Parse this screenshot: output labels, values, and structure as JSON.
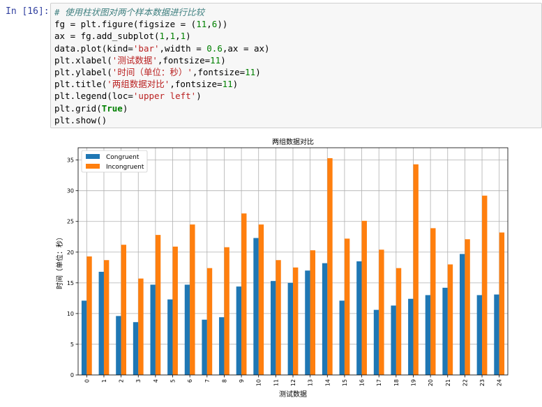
{
  "cell": {
    "prompt": "In [16]:",
    "code_lines": [
      [
        {
          "t": "# 使用柱状图对两个样本数据进行比较",
          "c": "comment"
        }
      ],
      [
        {
          "t": "fg = plt.figure(figsize = ("
        },
        {
          "t": "11",
          "c": "num"
        },
        {
          "t": ","
        },
        {
          "t": "6",
          "c": "num"
        },
        {
          "t": "))"
        }
      ],
      [
        {
          "t": "ax = fg.add_subplot("
        },
        {
          "t": "1",
          "c": "num"
        },
        {
          "t": ","
        },
        {
          "t": "1",
          "c": "num"
        },
        {
          "t": ","
        },
        {
          "t": "1",
          "c": "num"
        },
        {
          "t": ")"
        }
      ],
      [
        {
          "t": "data.plot(kind="
        },
        {
          "t": "'bar'",
          "c": "str"
        },
        {
          "t": ",width = "
        },
        {
          "t": "0.6",
          "c": "num"
        },
        {
          "t": ",ax = ax)"
        }
      ],
      [
        {
          "t": "plt.xlabel("
        },
        {
          "t": "'测试数据'",
          "c": "str"
        },
        {
          "t": ",fontsize="
        },
        {
          "t": "11",
          "c": "num"
        },
        {
          "t": ")"
        }
      ],
      [
        {
          "t": "plt.ylabel("
        },
        {
          "t": "'时间（单位：秒）'",
          "c": "str"
        },
        {
          "t": ",fontsize="
        },
        {
          "t": "11",
          "c": "num"
        },
        {
          "t": ")"
        }
      ],
      [
        {
          "t": "plt.title("
        },
        {
          "t": "'两组数据对比'",
          "c": "str"
        },
        {
          "t": ",fontsize="
        },
        {
          "t": "11",
          "c": "num"
        },
        {
          "t": ")"
        }
      ],
      [
        {
          "t": "plt.legend(loc="
        },
        {
          "t": "'upper left'",
          "c": "str"
        },
        {
          "t": ")"
        }
      ],
      [
        {
          "t": "plt.grid("
        },
        {
          "t": "True",
          "c": "kw"
        },
        {
          "t": ")"
        }
      ],
      [
        {
          "t": "plt.show()"
        }
      ]
    ]
  },
  "chart_data": {
    "type": "bar",
    "title": "两组数据对比",
    "xlabel": "测试数据",
    "ylabel": "时间（单位：秒）",
    "categories": [
      "0",
      "1",
      "2",
      "3",
      "4",
      "5",
      "6",
      "7",
      "8",
      "9",
      "10",
      "11",
      "12",
      "13",
      "14",
      "15",
      "16",
      "17",
      "18",
      "19",
      "20",
      "21",
      "22",
      "23",
      "24"
    ],
    "series": [
      {
        "name": "Congruent",
        "color": "#1f77b4",
        "values": [
          12.1,
          16.8,
          9.6,
          8.6,
          14.7,
          12.3,
          14.7,
          9.0,
          9.4,
          14.4,
          22.3,
          15.3,
          15.0,
          17.0,
          18.2,
          12.1,
          18.5,
          10.6,
          11.3,
          12.4,
          13.0,
          14.2,
          19.7,
          13.0,
          13.1
        ]
      },
      {
        "name": "Incongruent",
        "color": "#ff7f0e",
        "values": [
          19.3,
          18.7,
          21.2,
          15.7,
          22.8,
          20.9,
          24.5,
          17.4,
          20.8,
          26.3,
          24.5,
          18.7,
          17.5,
          20.3,
          35.3,
          22.2,
          25.1,
          20.4,
          17.4,
          34.3,
          23.9,
          18.0,
          22.1,
          29.2,
          23.2
        ]
      }
    ],
    "ylim": [
      0,
      37
    ],
    "yticks": [
      0,
      5,
      10,
      15,
      20,
      25,
      30,
      35
    ],
    "grid": true,
    "legend_loc": "upper left",
    "bar_width": 0.6
  }
}
